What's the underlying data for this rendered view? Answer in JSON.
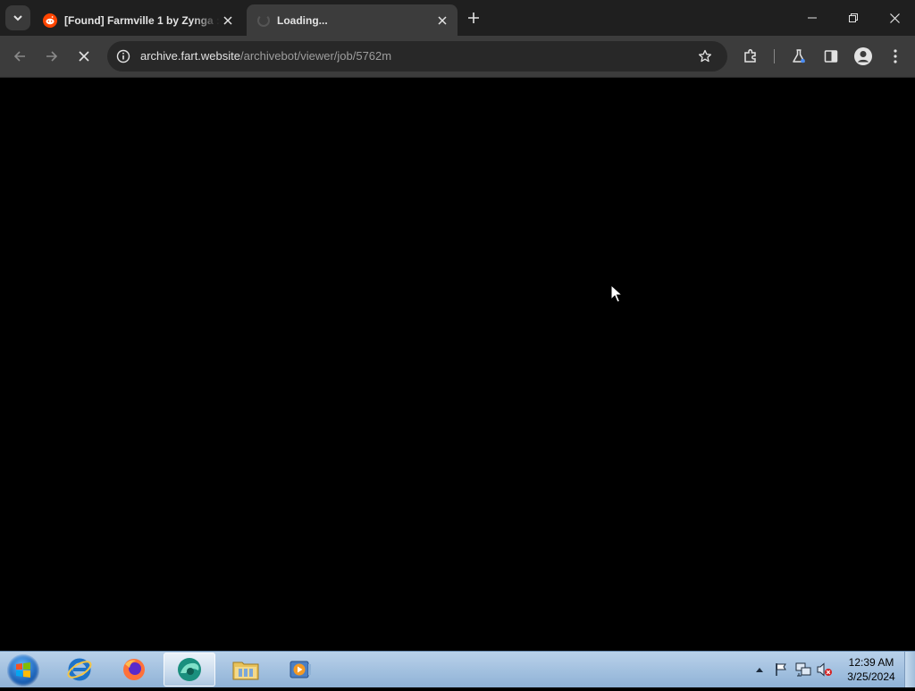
{
  "browser": {
    "tabs": [
      {
        "title": "[Found] Farmville 1 by Zynga :",
        "favicon": "reddit-icon",
        "active": false
      },
      {
        "title": "Loading...",
        "favicon": "loading-spinner-icon",
        "active": true
      }
    ],
    "address_bar": {
      "host": "archive.fart.website",
      "path": "/archivebot/viewer/job/5762m"
    }
  },
  "taskbar": {
    "pinned": [
      "internet-explorer-icon",
      "firefox-icon",
      "browser-icon",
      "file-explorer-icon",
      "media-player-icon"
    ],
    "clock": {
      "time": "12:39 AM",
      "date": "3/25/2024"
    }
  },
  "colors": {
    "tabstrip": "#1f1f1f",
    "toolbar": "#3c3c3c",
    "omnibox": "#282828",
    "viewport": "#000000",
    "taskbar": "#a9c6e3"
  }
}
